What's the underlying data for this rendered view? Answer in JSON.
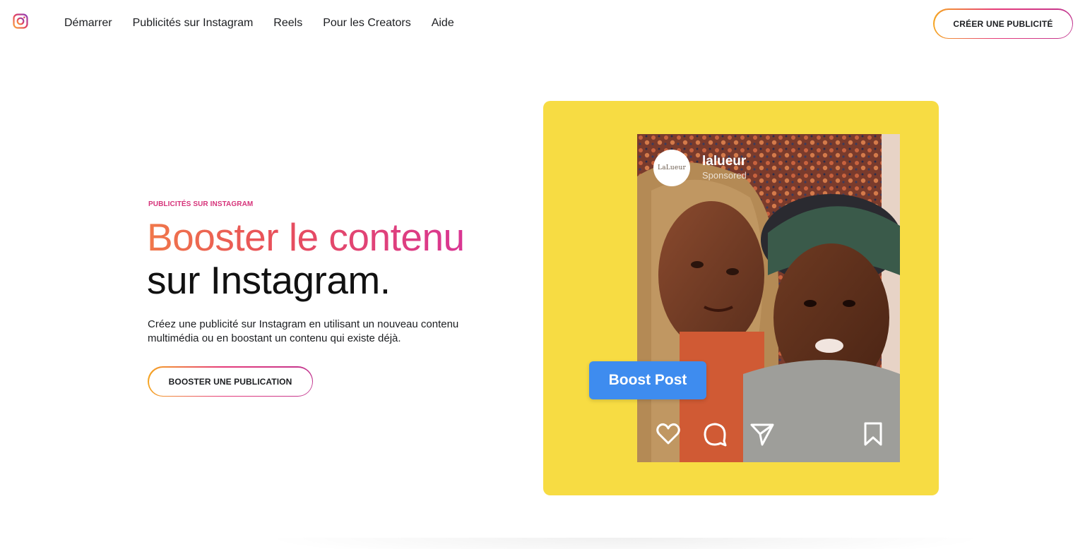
{
  "nav": {
    "logo_icon": "instagram-logo-icon",
    "links": [
      "Démarrer",
      "Publicités sur Instagram",
      "Reels",
      "Pour les Creators",
      "Aide"
    ],
    "cta_label": "CRÉER UNE PUBLICITÉ"
  },
  "hero": {
    "eyebrow": "PUBLICITÉS SUR INSTAGRAM",
    "headline_line1": "Booster le contenu",
    "headline_line2": "sur Instagram.",
    "description": "Créez une publicité sur Instagram en utilisant un nouveau contenu multimédia ou en boostant un contenu qui existe déjà.",
    "cta_label": "BOOSTER UNE PUBLICATION"
  },
  "media": {
    "card_color": "#f7dc43",
    "avatar_text": "LaLueur",
    "account_handle": "lalueur",
    "sponsored_label": "Sponsored",
    "boost_button_label": "Boost Post",
    "action_icons": [
      "heart-icon",
      "comment-icon",
      "share-icon",
      "bookmark-icon"
    ]
  },
  "colors": {
    "accent_gradient_start": "#f5a623",
    "accent_gradient_mid": "#e63b7a",
    "accent_gradient_end": "#c1358f",
    "eyebrow": "#d6337a",
    "boost_blue": "#3e8cef"
  }
}
